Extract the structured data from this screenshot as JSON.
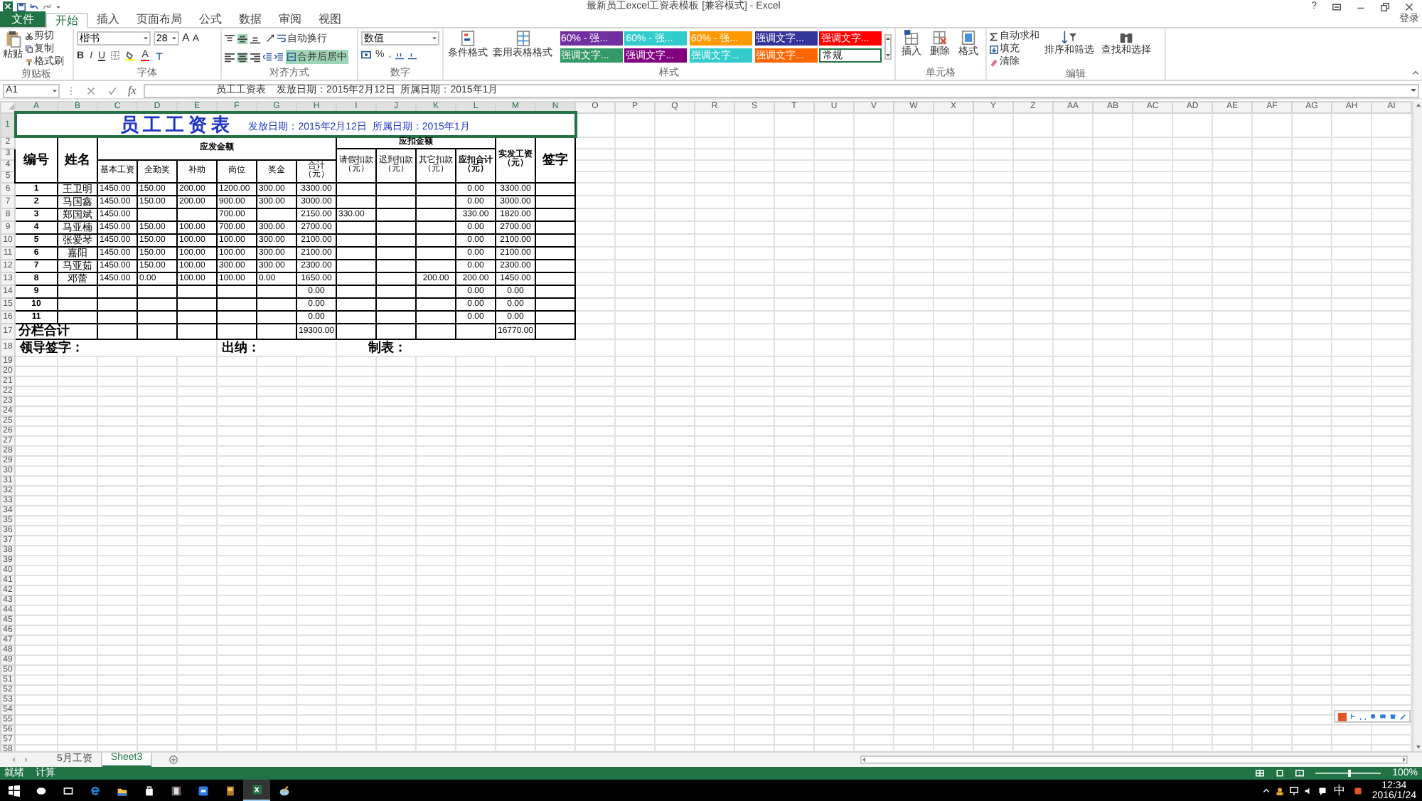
{
  "window": {
    "title": "最新员工excel工资表模板  [兼容模式] - Excel",
    "help": "?"
  },
  "tabs": [
    {
      "label": "文件",
      "kind": "file",
      "selected": false
    },
    {
      "label": "开始",
      "kind": "tab",
      "selected": true
    },
    {
      "label": "插入",
      "kind": "tab",
      "selected": false
    },
    {
      "label": "页面布局",
      "kind": "tab",
      "selected": false
    },
    {
      "label": "公式",
      "kind": "tab",
      "selected": false
    },
    {
      "label": "数据",
      "kind": "tab",
      "selected": false
    },
    {
      "label": "审阅",
      "kind": "tab",
      "selected": false
    },
    {
      "label": "视图",
      "kind": "tab",
      "selected": false
    }
  ],
  "account": "登录",
  "ribbon": {
    "clipboard": {
      "paste": "粘贴",
      "cut": "剪切",
      "copy": "复制",
      "format_painter": "格式刷",
      "label": "剪贴板"
    },
    "font": {
      "name": "楷书",
      "size": "28",
      "grow_font": "A",
      "shrink_font": "A",
      "styles": [
        "B",
        "I",
        "U"
      ],
      "font_color": "A",
      "label": "字体"
    },
    "alignment": {
      "align_buttons": [
        {
          "kind": "top",
          "selected": false
        },
        {
          "kind": "middle",
          "selected": true
        },
        {
          "kind": "bottom",
          "selected": false
        },
        {
          "kind": "left",
          "selected": false
        },
        {
          "kind": "center",
          "selected": true
        },
        {
          "kind": "right",
          "selected": false
        }
      ],
      "wrap": "自动换行",
      "merge": {
        "label": "合并后居中",
        "selected": true
      },
      "label": "对齐方式"
    },
    "number": {
      "format": "数值",
      "percent": "%",
      "comma": ",",
      "label": "数字"
    },
    "styles": {
      "conditional": "条件格式",
      "table": "套用表格格式",
      "swatches": [
        {
          "label": "60% - 强...",
          "color": "#7030a0",
          "selected": false
        },
        {
          "label": "60% - 强...",
          "color": "#33cccc",
          "selected": false
        },
        {
          "label": "60% - 强...",
          "color": "#ff9900",
          "selected": false
        },
        {
          "label": "强调文字...",
          "color": "#333399",
          "selected": false
        },
        {
          "label": "强调文字...",
          "color": "#ff0000",
          "selected": false
        },
        {
          "label": "强调文字...",
          "color": "#339966",
          "selected": false
        },
        {
          "label": "强调文字...",
          "color": "#800080",
          "selected": false
        },
        {
          "label": "强调文字...",
          "color": "#33cccc",
          "selected": false
        },
        {
          "label": "强调文字...",
          "color": "#ff6600",
          "selected": false
        },
        {
          "label": "常规",
          "color": "#ffffff",
          "selected": true
        }
      ],
      "label": "样式"
    },
    "cells": {
      "insert": "插入",
      "delete": "删除",
      "format": "格式",
      "label": "单元格"
    },
    "editing": {
      "autosum": "自动求和",
      "fill": "填充",
      "clear": "清除",
      "sort": "排序和筛选",
      "find": "查找和选择",
      "label": "编辑"
    }
  },
  "formula_bar": {
    "name_box": "A1",
    "function_button": "fx",
    "formula": "员工工资表    发放日期：2015年2月12日  所属日期：2015年1月"
  },
  "sheet": {
    "columns": [
      {
        "label": "A",
        "selected": true
      },
      {
        "label": "B",
        "selected": true
      },
      {
        "label": "C",
        "selected": true
      },
      {
        "label": "D",
        "selected": true
      },
      {
        "label": "E",
        "selected": true
      },
      {
        "label": "F",
        "selected": true
      },
      {
        "label": "G",
        "selected": true
      },
      {
        "label": "H",
        "selected": true
      },
      {
        "label": "I",
        "selected": true
      },
      {
        "label": "J",
        "selected": true
      },
      {
        "label": "K",
        "selected": true
      },
      {
        "label": "L",
        "selected": true
      },
      {
        "label": "M",
        "selected": true
      },
      {
        "label": "N",
        "selected": true
      },
      {
        "label": "O",
        "selected": false
      },
      {
        "label": "P",
        "selected": false
      },
      {
        "label": "Q",
        "selected": false
      },
      {
        "label": "R",
        "selected": false
      },
      {
        "label": "S",
        "selected": false
      },
      {
        "label": "T",
        "selected": false
      },
      {
        "label": "U",
        "selected": false
      },
      {
        "label": "V",
        "selected": false
      },
      {
        "label": "W",
        "selected": false
      },
      {
        "label": "X",
        "selected": false
      },
      {
        "label": "Y",
        "selected": false
      },
      {
        "label": "Z",
        "selected": false
      },
      {
        "label": "AA",
        "selected": false
      },
      {
        "label": "AB",
        "selected": false
      },
      {
        "label": "AC",
        "selected": false
      },
      {
        "label": "AD",
        "selected": false
      },
      {
        "label": "AE",
        "selected": false
      },
      {
        "label": "AF",
        "selected": false
      },
      {
        "label": "AG",
        "selected": false
      },
      {
        "label": "AH",
        "selected": false
      },
      {
        "label": "AI",
        "selected": false
      }
    ],
    "rows": [
      {
        "label": "1",
        "selected": true
      },
      {
        "label": "2",
        "selected": false
      },
      {
        "label": "3",
        "selected": false
      },
      {
        "label": "4",
        "selected": false
      },
      {
        "label": "5",
        "selected": false
      },
      {
        "label": "6",
        "selected": false
      },
      {
        "label": "7",
        "selected": false
      },
      {
        "label": "8",
        "selected": false
      },
      {
        "label": "9",
        "selected": false
      },
      {
        "label": "10",
        "selected": false
      },
      {
        "label": "11",
        "selected": false
      },
      {
        "label": "12",
        "selected": false
      },
      {
        "label": "13",
        "selected": false
      },
      {
        "label": "14",
        "selected": false
      },
      {
        "label": "15",
        "selected": false
      },
      {
        "label": "16",
        "selected": false
      },
      {
        "label": "17",
        "selected": false
      },
      {
        "label": "18",
        "selected": false
      },
      {
        "label": "19",
        "selected": false
      },
      {
        "label": "20",
        "selected": false
      },
      {
        "label": "21",
        "selected": false
      },
      {
        "label": "22",
        "selected": false
      },
      {
        "label": "23",
        "selected": false
      },
      {
        "label": "24",
        "selected": false
      },
      {
        "label": "25",
        "selected": false
      },
      {
        "label": "26",
        "selected": false
      },
      {
        "label": "27",
        "selected": false
      },
      {
        "label": "28",
        "selected": false
      },
      {
        "label": "29",
        "selected": false
      },
      {
        "label": "30",
        "selected": false
      },
      {
        "label": "31",
        "selected": false
      },
      {
        "label": "32",
        "selected": false
      },
      {
        "label": "33",
        "selected": false
      },
      {
        "label": "34",
        "selected": false
      },
      {
        "label": "35",
        "selected": false
      },
      {
        "label": "36",
        "selected": false
      },
      {
        "label": "37",
        "selected": false
      },
      {
        "label": "38",
        "selected": false
      },
      {
        "label": "39",
        "selected": false
      },
      {
        "label": "40",
        "selected": false
      },
      {
        "label": "41",
        "selected": false
      },
      {
        "label": "42",
        "selected": false
      },
      {
        "label": "43",
        "selected": false
      },
      {
        "label": "44",
        "selected": false
      },
      {
        "label": "45",
        "selected": false
      },
      {
        "label": "46",
        "selected": false
      },
      {
        "label": "47",
        "selected": false
      },
      {
        "label": "48",
        "selected": false
      },
      {
        "label": "49",
        "selected": false
      },
      {
        "label": "50",
        "selected": false
      },
      {
        "label": "51",
        "selected": false
      },
      {
        "label": "52",
        "selected": false
      },
      {
        "label": "53",
        "selected": false
      },
      {
        "label": "54",
        "selected": false
      },
      {
        "label": "55",
        "selected": false
      },
      {
        "label": "56",
        "selected": false
      },
      {
        "label": "57",
        "selected": false
      },
      {
        "label": "58",
        "selected": false
      }
    ]
  },
  "payroll": {
    "title": "员工工资表",
    "subtitle": "发放日期：2015年2月12日  所属日期：2015年1月",
    "headers": {
      "number": "编号",
      "name": "姓名",
      "gross_group": "应发金额",
      "gross": [
        "基本工资",
        "全勤奖",
        "补助",
        "岗位",
        "奖金",
        "合计（元）"
      ],
      "deduction_group": "应扣金额",
      "deductions": [
        "请假扣款（元）",
        "迟到扣款（元）",
        "其它扣款（元）",
        "应扣合计（元）"
      ],
      "net": "实发工资（元）",
      "signature": "签字"
    },
    "rows": [
      {
        "cells": [
          "1",
          "王卫明",
          "1450.00",
          "150.00",
          "200.00",
          "1200.00",
          "300.00",
          "3300.00",
          null,
          null,
          null,
          "0.00",
          "3300.00",
          null
        ]
      },
      {
        "cells": [
          "2",
          "马国鑫",
          "1450.00",
          "150.00",
          "200.00",
          "900.00",
          "300.00",
          "3000.00",
          null,
          null,
          null,
          "0.00",
          "3000.00",
          null
        ]
      },
      {
        "cells": [
          "3",
          "郑国斌",
          "1450.00",
          null,
          null,
          "700.00",
          null,
          "2150.00",
          "330.00",
          null,
          null,
          "330.00",
          "1820.00",
          null
        ]
      },
      {
        "cells": [
          "4",
          "马亚楠",
          "1450.00",
          "150.00",
          "100.00",
          "700.00",
          "300.00",
          "2700.00",
          null,
          null,
          null,
          "0.00",
          "2700.00",
          null
        ]
      },
      {
        "cells": [
          "5",
          "张爱琴",
          "1450.00",
          "150.00",
          "100.00",
          "100.00",
          "300.00",
          "2100.00",
          null,
          null,
          null,
          "0.00",
          "2100.00",
          null
        ]
      },
      {
        "cells": [
          "6",
          "嘉阳",
          "1450.00",
          "150.00",
          "100.00",
          "100.00",
          "300.00",
          "2100.00",
          null,
          null,
          null,
          "0.00",
          "2100.00",
          null
        ]
      },
      {
        "cells": [
          "7",
          "马亚茹",
          "1450.00",
          "150.00",
          "100.00",
          "300.00",
          "300.00",
          "2300.00",
          null,
          null,
          null,
          "0.00",
          "2300.00",
          null
        ]
      },
      {
        "cells": [
          "8",
          "邓蕾",
          "1450.00",
          "0.00",
          "100.00",
          "100.00",
          "0.00",
          "1650.00",
          null,
          null,
          "200.00",
          "200.00",
          "1450.00",
          null
        ]
      },
      {
        "cells": [
          "9",
          null,
          null,
          null,
          null,
          null,
          null,
          "0.00",
          null,
          null,
          null,
          "0.00",
          "0.00",
          null
        ]
      },
      {
        "cells": [
          "10",
          null,
          null,
          null,
          null,
          null,
          null,
          "0.00",
          null,
          null,
          null,
          "0.00",
          "0.00",
          null
        ]
      },
      {
        "cells": [
          "11",
          null,
          null,
          null,
          null,
          null,
          null,
          "0.00",
          null,
          null,
          null,
          "0.00",
          "0.00",
          null
        ]
      }
    ],
    "total": {
      "label": "分栏合计",
      "gross_total": "19300.00",
      "net_total": "16770.00"
    },
    "signatures": [
      "领导签字：",
      "出纳：",
      "制表："
    ]
  },
  "sheet_tabs": [
    {
      "label": "5月工资",
      "selected": false
    },
    {
      "label": "Sheet3",
      "selected": true
    }
  ],
  "status_bar": {
    "mode": "就绪",
    "calc": "计算",
    "zoom": "100%",
    "level": 0.5
  },
  "taskbar": {
    "ime": "中",
    "time": "12:34",
    "date": "2016/1/24"
  }
}
